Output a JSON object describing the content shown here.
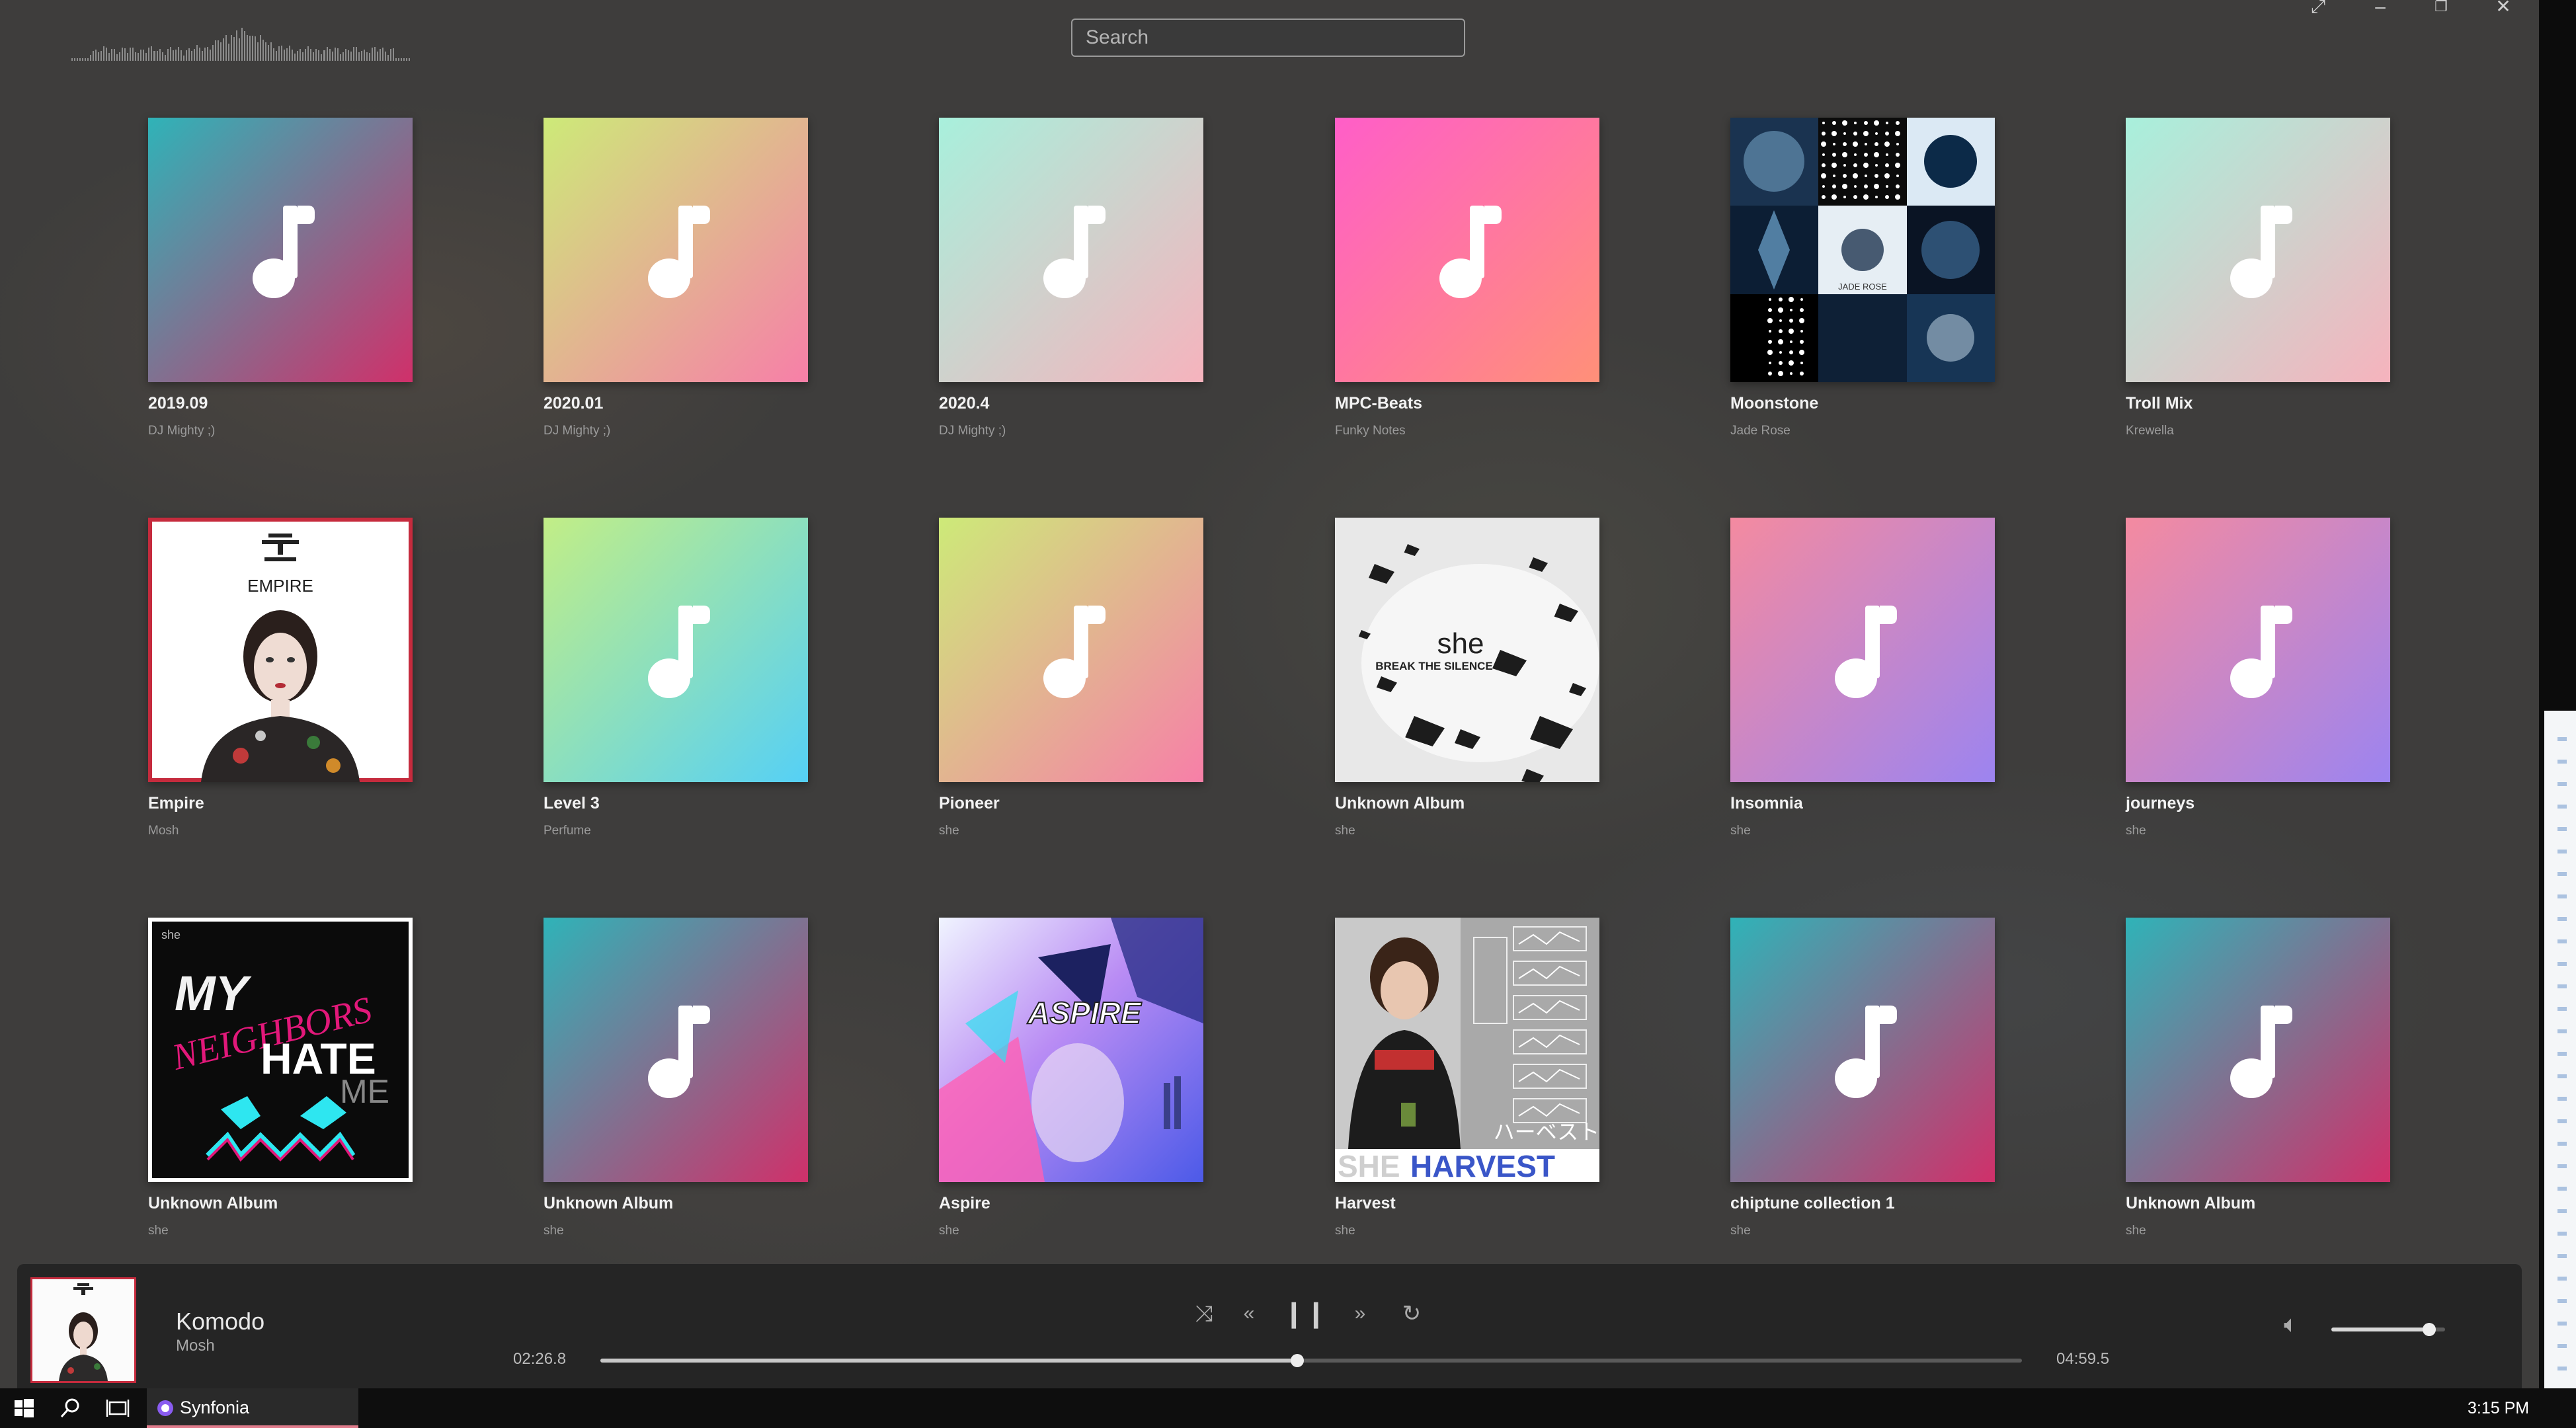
{
  "search": {
    "placeholder": "Search"
  },
  "window_controls": {
    "expand_icon": "expand-icon",
    "minimize_icon": "minimize-icon",
    "restore_icon": "restore-icon",
    "close_icon": "close-icon"
  },
  "albums": [
    {
      "title": "2019.09",
      "artist": "DJ Mighty ;)",
      "cover": "teal-pink"
    },
    {
      "title": "2020.01",
      "artist": "DJ Mighty ;)",
      "cover": "lime-pink"
    },
    {
      "title": "2020.4",
      "artist": "DJ Mighty ;)",
      "cover": "mint-rose"
    },
    {
      "title": "MPC-Beats",
      "artist": "Funky Notes",
      "cover": "magenta-salmon"
    },
    {
      "title": "Moonstone",
      "artist": "Jade Rose",
      "cover": "art-moonstone"
    },
    {
      "title": "Troll Mix",
      "artist": "Krewella",
      "cover": "mint-rose"
    },
    {
      "title": "Empire",
      "artist": "Mosh",
      "cover": "art-empire"
    },
    {
      "title": "Level 3",
      "artist": "Perfume",
      "cover": "lime-cyan"
    },
    {
      "title": "Pioneer",
      "artist": "she",
      "cover": "lime-pink"
    },
    {
      "title": "Unknown Album",
      "artist": "she",
      "cover": "art-silence"
    },
    {
      "title": "Insomnia",
      "artist": "she",
      "cover": "coral-violet"
    },
    {
      "title": "journeys",
      "artist": "she",
      "cover": "coral-violet"
    },
    {
      "title": "Unknown Album",
      "artist": "she",
      "cover": "art-neighbors"
    },
    {
      "title": "Unknown Album",
      "artist": "she",
      "cover": "teal-pink"
    },
    {
      "title": "Aspire",
      "artist": "she",
      "cover": "art-aspire"
    },
    {
      "title": "Harvest",
      "artist": "she",
      "cover": "art-harvest"
    },
    {
      "title": "chiptune collection 1",
      "artist": "she",
      "cover": "teal-pink"
    },
    {
      "title": "Unknown Album",
      "artist": "she",
      "cover": "teal-pink"
    }
  ],
  "cover_art_text": {
    "empire": "EMPIRE",
    "silence_she": "she",
    "silence_title": "BREAK THE SILENCE",
    "moonstone": "JADE ROSE",
    "neighbors_she": "she",
    "neighbors_my": "MY",
    "neighbors_neighbors": "NEIGHBORS",
    "neighbors_hate": "HATE",
    "neighbors_me": "ME",
    "aspire": "ASPIRE",
    "harvest_she": "SHE",
    "harvest_title": "HARVEST",
    "harvest_jp": "ハーベスト"
  },
  "gradients": {
    "teal-pink": [
      "#2fb3b8",
      "#d0306a"
    ],
    "lime-pink": [
      "#cdea78",
      "#f77fa8"
    ],
    "mint-rose": [
      "#a8f0dc",
      "#f6b3bd"
    ],
    "magenta-salmon": [
      "#ff5ec8",
      "#ff9078"
    ],
    "lime-cyan": [
      "#c2ee86",
      "#55d0f6"
    ],
    "coral-violet": [
      "#f48aa0",
      "#9c84f0"
    ]
  },
  "player": {
    "track_title": "Komodo",
    "track_artist": "Mosh",
    "current_time": "02:26.8",
    "total_time": "04:59.5",
    "progress": 0.49,
    "volume": 0.86,
    "shuffle_icon": "shuffle-icon",
    "previous_icon": "previous-icon",
    "pause_icon": "pause-icon",
    "next_icon": "next-icon",
    "repeat_icon": "repeat-icon",
    "volume_icon": "volume-icon"
  },
  "taskbar": {
    "app_label": "Synfonia",
    "clock": "3:15 PM",
    "start_icon": "windows-start-icon",
    "search_icon": "search-icon",
    "task_view_icon": "task-view-icon"
  }
}
